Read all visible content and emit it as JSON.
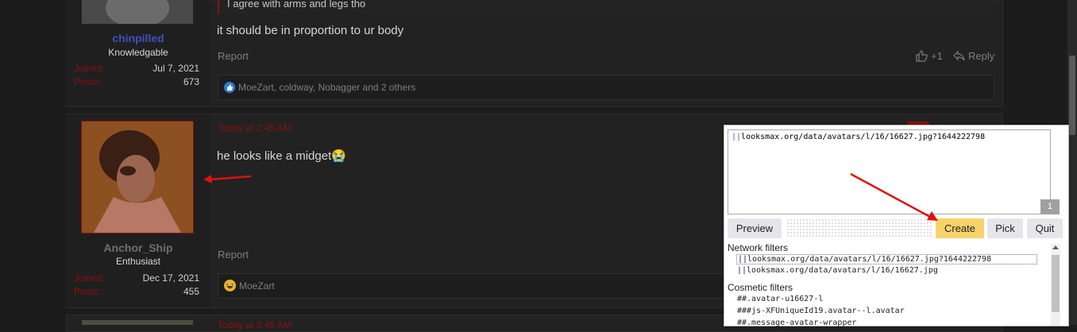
{
  "post1": {
    "quote_text": "I agree with arms and legs tho",
    "message": "it should be in proportion to ur body",
    "username": "chinpilled",
    "user_title": "Knowledgable",
    "joined_label": "Joined:",
    "joined_value": "Jul 7, 2021",
    "posts_label": "Posts:",
    "posts_value": "673",
    "report_label": "Report",
    "like_count": "+1",
    "reply_label": "Reply",
    "reactions": "MoeZart, coldway, Nobagger and 2 others"
  },
  "post2": {
    "timestamp": "Today at 2:45 AM",
    "message": "he looks like a midget😭",
    "username": "Anchor_Ship",
    "user_title": "Enthusiast",
    "joined_label": "Joined:",
    "joined_value": "Dec 17, 2021",
    "posts_label": "Posts:",
    "posts_value": "455",
    "report_label": "Report",
    "reactions": "MoeZart"
  },
  "post3": {
    "timestamp": "Today at 2:45 AM"
  },
  "picker": {
    "filter_text": "||looksmax.org/data/avatars/l/16/16627.jpg?1644222798",
    "match_count": "1",
    "preview_label": "Preview",
    "create_label": "Create",
    "pick_label": "Pick",
    "quit_label": "Quit",
    "network_heading": "Network filters",
    "network_filters": [
      "||looksmax.org/data/avatars/l/16/16627.jpg?1644222798",
      "||looksmax.org/data/avatars/l/16/16627.jpg"
    ],
    "cosmetic_heading": "Cosmetic filters",
    "cosmetic_filters": [
      "##.avatar-u16627-l",
      "###js-XFUniqueId19.avatar--l.avatar",
      "##.message-avatar-wrapper"
    ]
  },
  "colors": {
    "page_bg": "#1c1c1c",
    "accent_red": "#8b1010",
    "create_button": "#f7d36b",
    "username1": "#3f4fbf"
  }
}
